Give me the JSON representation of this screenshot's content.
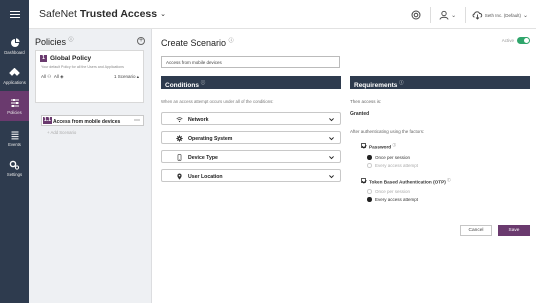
{
  "app": {
    "brand_name": "SafeNet",
    "brand_product": "Trusted Access",
    "account_label": "Seth Inc. (Default)"
  },
  "sidebar": {
    "items": [
      {
        "label": "Dashboard",
        "icon": "dashboard-icon",
        "active": false
      },
      {
        "label": "Applications",
        "icon": "applications-icon",
        "active": false
      },
      {
        "label": "Policies",
        "icon": "policies-icon",
        "active": true
      },
      {
        "label": "Events",
        "icon": "events-icon",
        "active": false
      },
      {
        "label": "Settings",
        "icon": "settings-icon",
        "active": false
      }
    ]
  },
  "policies": {
    "title": "Policies",
    "global_policy": {
      "number": "1",
      "title": "Global Policy",
      "description": "Your default Policy for all the Users and Applications",
      "users": "All",
      "apps": "All",
      "scenario_count": "1 Scenario"
    },
    "scenario": {
      "number": "1.1",
      "label": "Access from mobile devices"
    },
    "add_scenario": "+ Add Scenario"
  },
  "scenario_editor": {
    "title": "Create Scenario",
    "active_label": "Active",
    "name_value": "Access from mobile devices"
  },
  "conditions": {
    "title": "Conditions",
    "subtitle": "When an access attempt occurs under all of the conditions:",
    "items": [
      {
        "label": "Network",
        "icon": "wifi-icon"
      },
      {
        "label": "Operating System",
        "icon": "gear-icon"
      },
      {
        "label": "Device Type",
        "icon": "mobile-device-icon"
      },
      {
        "label": "User Location",
        "icon": "location-pin-icon"
      }
    ]
  },
  "requirements": {
    "title": "Requirements",
    "access_label": "Then access is:",
    "access_value": "Granted",
    "factors_label": "After authenticating using the factors:",
    "password": {
      "label": "Password",
      "options": [
        "Once per session",
        "Every access attempt"
      ],
      "selected": 0
    },
    "otp": {
      "label": "Token Based Authentication (OTP)",
      "options": [
        "Once per session",
        "Every access attempt"
      ],
      "selected": 1
    }
  },
  "actions": {
    "cancel": "Cancel",
    "save": "Save"
  },
  "colors": {
    "nav_bg": "#2e3b4e",
    "accent": "#6a3a6e",
    "toggle_on": "#2fa56b"
  }
}
